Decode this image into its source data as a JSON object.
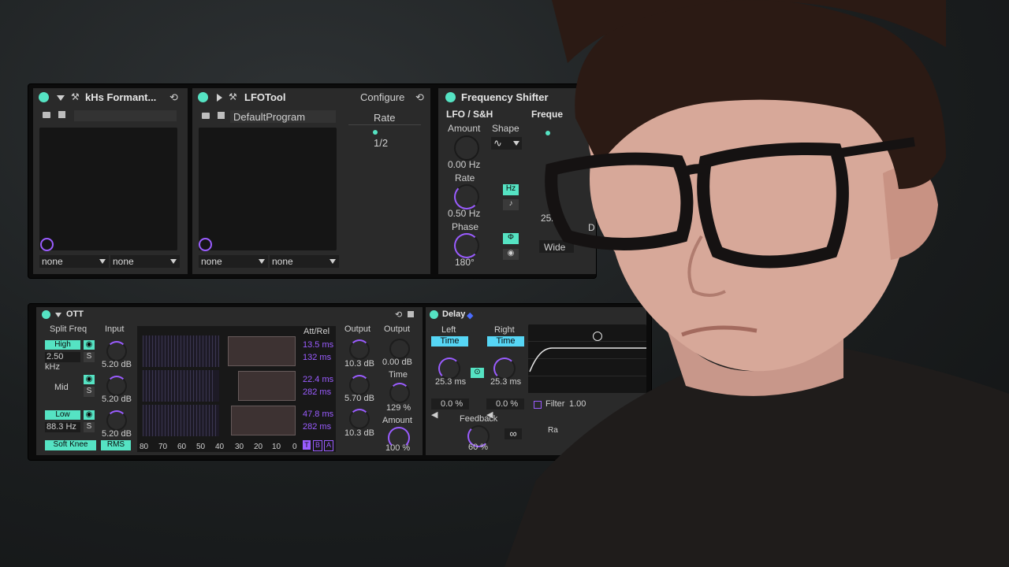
{
  "colors": {
    "accent_green": "#55e3c3",
    "accent_purple": "#9a5cff",
    "accent_blue": "#56d6f5"
  },
  "rack1": {
    "formant": {
      "title": "kHs Formant...",
      "dropdowns": [
        "none",
        "none"
      ],
      "icons": [
        "power-icon",
        "wrench-icon",
        "folder-icon",
        "save-icon"
      ]
    },
    "lfotool": {
      "title": "LFOTool",
      "configure": "Configure",
      "program": "DefaultProgram",
      "rate_label": "Rate",
      "rate_value": "1/2",
      "dropdowns": [
        "none",
        "none"
      ]
    },
    "freqshift": {
      "title": "Frequency Shifter",
      "lfo_title": "LFO / S&H",
      "amount_label": "Amount",
      "amount_value": "0.00 Hz",
      "shape_label": "Shape",
      "rate_label": "Rate",
      "rate_value": "0.50 Hz",
      "phase_label": "Phase",
      "phase_value": "180°",
      "hz_button": "Hz",
      "freq_label": "Freque",
      "fine_value": "252",
      "wide_label": "Wide",
      "d_label": "D"
    }
  },
  "rack2": {
    "ott": {
      "title": "OTT",
      "split_freq": "Split Freq",
      "input_label": "Input",
      "high": "High",
      "high_freq": "2.50 kHz",
      "mid": "Mid",
      "low": "Low",
      "low_freq": "88.3 Hz",
      "s": "S",
      "input_values": [
        "5.20 dB",
        "5.20 dB",
        "5.20 dB"
      ],
      "att_rel": "Att/Rel",
      "att_rel_values": [
        "13.5 ms",
        "132 ms",
        "22.4 ms",
        "282 ms",
        "47.8 ms",
        "282 ms"
      ],
      "scale": [
        "80",
        "70",
        "60",
        "50",
        "40",
        "30",
        "20",
        "10",
        "0"
      ],
      "tba": [
        "T",
        "B",
        "A"
      ],
      "output_label": "Output",
      "output_values": [
        "10.3 dB",
        "5.70 dB",
        "10.3 dB"
      ],
      "master_output_label": "Output",
      "master_output_value": "0.00 dB",
      "time_label": "Time",
      "time_value": "129 %",
      "amount_label": "Amount",
      "amount_value": "100 %",
      "soft_knee": "Soft Knee",
      "rms": "RMS"
    },
    "delay": {
      "title": "Delay",
      "left": "Left",
      "right": "Right",
      "time": "Time",
      "left_value": "25.3 ms",
      "right_value": "25.3 ms",
      "left_offset": "0.0 %",
      "right_offset": "0.0 %",
      "feedback_label": "Feedback",
      "feedback_value": "60 %",
      "filter_label": "Filter",
      "filter_value": "1.00",
      "ra_label": "Ra"
    }
  }
}
